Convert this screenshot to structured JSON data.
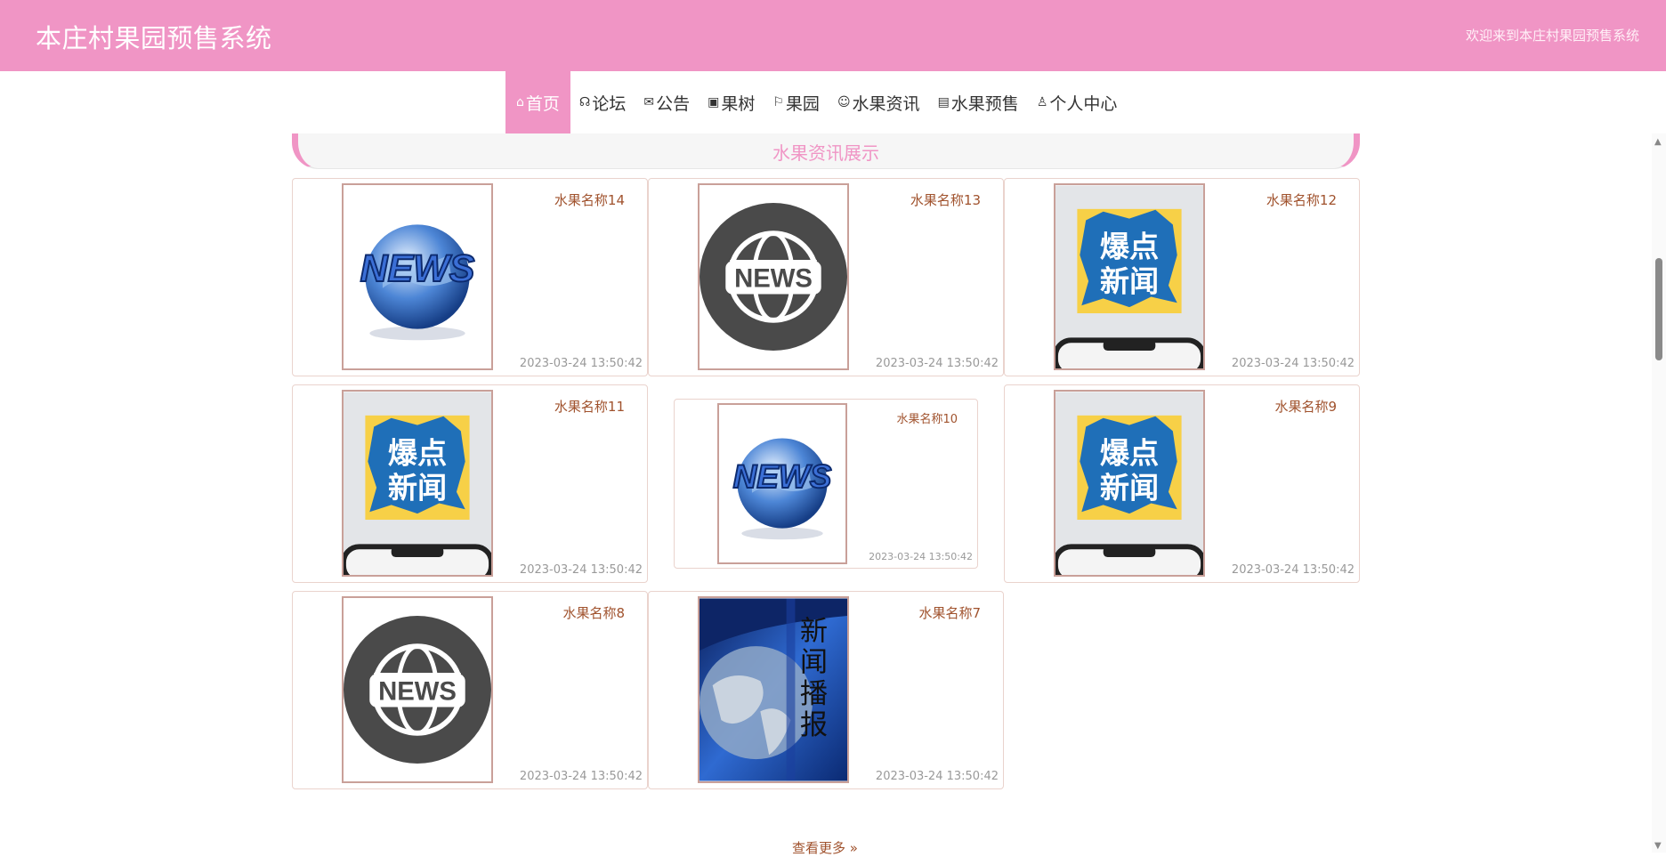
{
  "header": {
    "title": "本庄村果园预售系统",
    "welcome": "欢迎来到本庄村果园预售系统"
  },
  "nav": {
    "items": [
      {
        "label": "首页",
        "icon": "home-icon",
        "active": true
      },
      {
        "label": "论坛",
        "icon": "chat-icon"
      },
      {
        "label": "公告",
        "icon": "mail-icon"
      },
      {
        "label": "果树",
        "icon": "gift-icon"
      },
      {
        "label": "果园",
        "icon": "flag-icon"
      },
      {
        "label": "水果资讯",
        "icon": "smile-icon"
      },
      {
        "label": "水果预售",
        "icon": "clipboard-icon"
      },
      {
        "label": "个人中心",
        "icon": "user-icon"
      }
    ]
  },
  "section": {
    "title": "水果资讯展示"
  },
  "news": [
    {
      "title": "水果名称14",
      "time": "2023-03-24 13:50:42",
      "image": "globe-news"
    },
    {
      "title": "水果名称13",
      "time": "2023-03-24 13:50:42",
      "image": "news-circle"
    },
    {
      "title": "水果名称12",
      "time": "2023-03-24 13:50:42",
      "image": "bao-dian-xin-wen",
      "image_text": [
        "爆点",
        "新闻"
      ]
    },
    {
      "title": "水果名称11",
      "time": "2023-03-24 13:50:42",
      "image": "bao-dian-xin-wen",
      "image_text": [
        "爆点",
        "新闻"
      ]
    },
    {
      "title": "水果名称10",
      "time": "2023-03-24 13:50:42",
      "image": "globe-news"
    },
    {
      "title": "水果名称9",
      "time": "2023-03-24 13:50:42",
      "image": "bao-dian-xin-wen",
      "image_text": [
        "爆点",
        "新闻"
      ]
    },
    {
      "title": "水果名称8",
      "time": "2023-03-24 13:50:42",
      "image": "news-circle"
    },
    {
      "title": "水果名称7",
      "time": "2023-03-24 13:50:42",
      "image": "xin-wen-bo-bao",
      "image_text": "新闻播报"
    }
  ],
  "images": {
    "news_word": "NEWS"
  },
  "footer": {
    "more_label": "查看更多 »"
  },
  "colors": {
    "brand_pink": "#f095c5",
    "title_brown": "#a0522d",
    "time_gray": "#999999"
  }
}
